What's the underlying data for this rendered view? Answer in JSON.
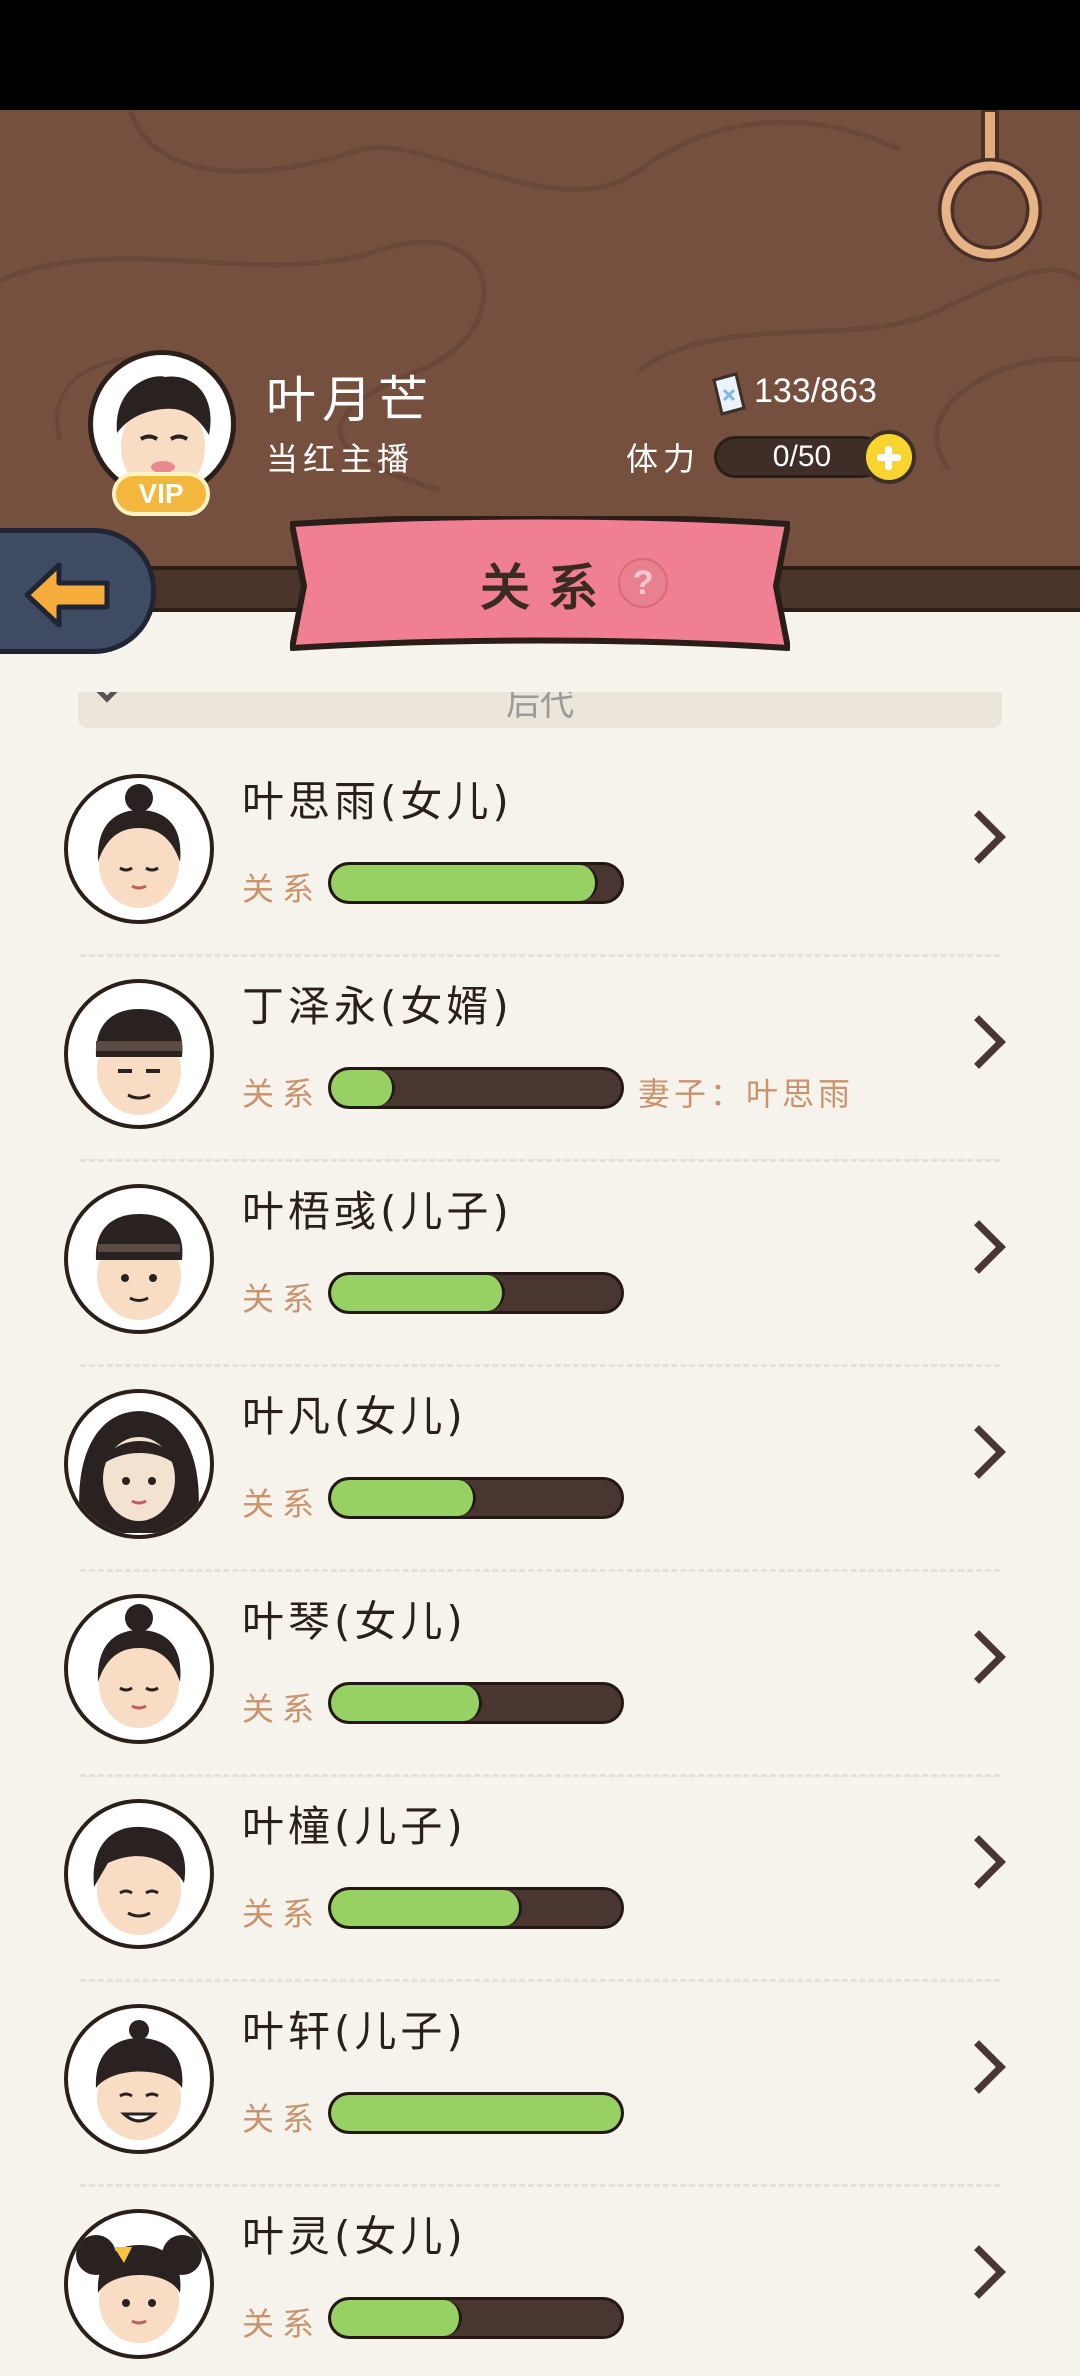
{
  "player": {
    "name": "叶月芒",
    "title": "当红主播",
    "vip_label": "VIP",
    "ticket_count": "133/863",
    "stamina_label": "体力",
    "stamina_value": "0/50"
  },
  "banner": {
    "title": "关系",
    "help_label": "?"
  },
  "section": {
    "label": "后代"
  },
  "relationship_label": "关系",
  "colors": {
    "bar_fill": "#97d163",
    "bar_bg": "#4a3631",
    "banner": "#f07f93",
    "header_wood": "#75503f"
  },
  "members": [
    {
      "name": "叶思雨(女儿)",
      "relation": 0.92,
      "spouse": "",
      "avatar": "girl-bun-icon"
    },
    {
      "name": "丁泽永(女婿)",
      "relation": 0.22,
      "spouse": "妻子：叶思雨",
      "avatar": "man-headband-icon"
    },
    {
      "name": "叶梧彧(儿子)",
      "relation": 0.6,
      "spouse": "",
      "avatar": "boy-headband-icon"
    },
    {
      "name": "叶凡(女儿)",
      "relation": 0.5,
      "spouse": "",
      "avatar": "girl-longhair-icon"
    },
    {
      "name": "叶琴(女儿)",
      "relation": 0.52,
      "spouse": "",
      "avatar": "girl-bun-icon"
    },
    {
      "name": "叶橦(儿子)",
      "relation": 0.66,
      "spouse": "",
      "avatar": "boy-icon"
    },
    {
      "name": "叶轩(儿子)",
      "relation": 1.0,
      "spouse": "",
      "avatar": "boy-topknot-icon"
    },
    {
      "name": "叶灵(女儿)",
      "relation": 0.45,
      "spouse": "",
      "avatar": "girl-twinbuns-icon"
    }
  ]
}
